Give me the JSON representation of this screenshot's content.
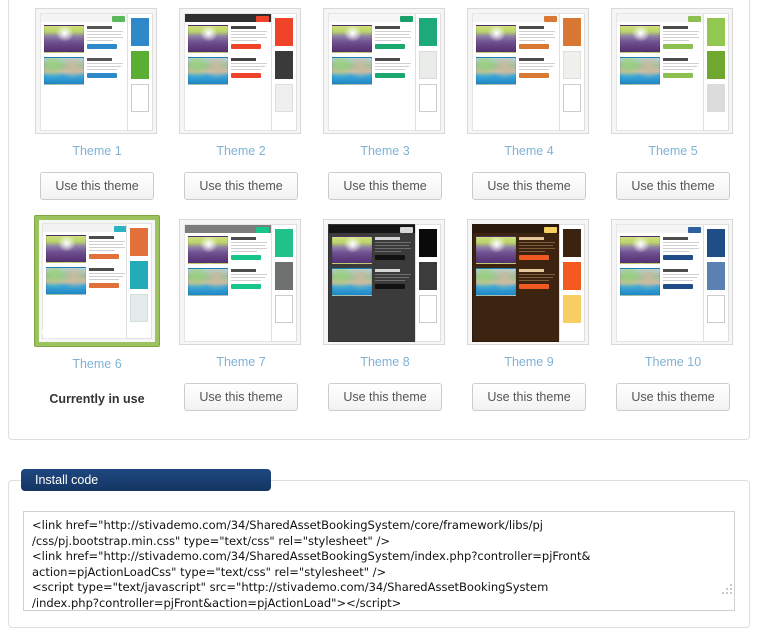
{
  "themes_panel": {
    "use_button_label": "Use this theme",
    "in_use_label": "Currently in use",
    "check_icon": "check-icon",
    "themes": [
      {
        "name": "Theme 1",
        "selected": false,
        "header_bg": "#f4f4f4",
        "top_button": "#5cb85c",
        "page_bg": "#ffffff",
        "text_color": "#9a9a9a",
        "title_color": "#555555",
        "cta": "#2f89c8",
        "swatches": [
          "#2f89c8",
          "#5aaf33",
          "#ffffff"
        ]
      },
      {
        "name": "Theme 2",
        "selected": false,
        "header_bg": "#2f2f2f",
        "top_button": "#f0442a",
        "page_bg": "#ffffff",
        "text_color": "#9a9a9a",
        "title_color": "#444444",
        "cta": "#f0442a",
        "swatches": [
          "#f0442a",
          "#3a3a3a",
          "#efefef"
        ]
      },
      {
        "name": "Theme 3",
        "selected": false,
        "header_bg": "#f6f6f6",
        "top_button": "#17a06a",
        "page_bg": "#ffffff",
        "text_color": "#9a9a9a",
        "title_color": "#4c4c4c",
        "cta": "#1aa86e",
        "swatches": [
          "#1da97a",
          "#e9ece9",
          "#ffffff"
        ]
      },
      {
        "name": "Theme 4",
        "selected": false,
        "header_bg": "#f5f5f5",
        "top_button": "#d97832",
        "page_bg": "#ffffff",
        "text_color": "#a0a0a0",
        "title_color": "#4c4c4c",
        "cta": "#d97832",
        "swatches": [
          "#d97832",
          "#f0f0ec",
          "#ffffff"
        ]
      },
      {
        "name": "Theme 5",
        "selected": false,
        "header_bg": "#f4f4f4",
        "top_button": "#8cc152",
        "page_bg": "#ffffff",
        "text_color": "#9a9a9a",
        "title_color": "#4c4c4c",
        "cta": "#8cc152",
        "swatches": [
          "#92c84f",
          "#6fa72f",
          "#dcdcdc"
        ]
      },
      {
        "name": "Theme 6",
        "selected": true,
        "header_bg": "#f2f2f2",
        "top_button": "#2bb3c0",
        "page_bg": "#ffffff",
        "text_color": "#9a9a9a",
        "title_color": "#4c4c4c",
        "cta": "#e2703a",
        "swatches": [
          "#e2703a",
          "#24aab8",
          "#e3eaea"
        ]
      },
      {
        "name": "Theme 7",
        "selected": false,
        "header_bg": "#7c7c7c",
        "top_button": "#16c68a",
        "page_bg": "#ffffff",
        "text_color": "#9a9a9a",
        "title_color": "#4c4c4c",
        "cta": "#16c68a",
        "swatches": [
          "#1fc389",
          "#6f7171",
          "#ffffff"
        ]
      },
      {
        "name": "Theme 8",
        "selected": false,
        "header_bg": "#151515",
        "top_button": "#d8d8d8",
        "page_bg": "#3b3b3b",
        "text_color": "#7b7b7b",
        "title_color": "#d6d6d6",
        "cta": "#111111",
        "swatches": [
          "#0a0a0a",
          "#3c3c3c",
          "#ffffff"
        ]
      },
      {
        "name": "Theme 9",
        "selected": false,
        "header_bg": "#2a1a0d",
        "top_button": "#f7cf5e",
        "page_bg": "#3d2411",
        "text_color": "#8a6a4a",
        "title_color": "#e4c79a",
        "cta": "#f05a22",
        "swatches": [
          "#3a2310",
          "#f4591f",
          "#f9cf63"
        ]
      },
      {
        "name": "Theme 10",
        "selected": false,
        "header_bg": "#f4f4f4",
        "top_button": "#2e5f9e",
        "page_bg": "#ffffff",
        "text_color": "#9a9a9a",
        "title_color": "#4c4c4c",
        "cta": "#1f4d8a",
        "swatches": [
          "#1f4d87",
          "#5b80b2",
          "#ffffff"
        ]
      }
    ]
  },
  "install_code": {
    "tab_label": "Install code",
    "code": "<link href=\"http://stivademo.com/34/SharedAssetBookingSystem/core/framework/libs/pj\n/css/pj.bootstrap.min.css\" type=\"text/css\" rel=\"stylesheet\" />\n<link href=\"http://stivademo.com/34/SharedAssetBookingSystem/index.php?controller=pjFront&\naction=pjActionLoadCss\" type=\"text/css\" rel=\"stylesheet\" />\n<script type=\"text/javascript\" src=\"http://stivademo.com/34/SharedAssetBookingSystem\n/index.php?controller=pjFront&action=pjActionLoad\"></script>"
  },
  "colors": {
    "selected_frame": "#9dc35e",
    "label_blue": "#7fb2d4",
    "tab_navy": "#1b3f73"
  }
}
